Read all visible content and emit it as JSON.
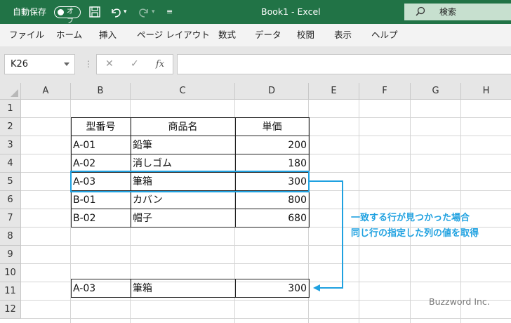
{
  "titlebar": {
    "autosave_label": "自動保存",
    "autosave_state": "オフ",
    "title": "Book1  -  Excel",
    "search_label": "検索",
    "bg_color": "#217346"
  },
  "menu": [
    "ファイル",
    "ホーム",
    "挿入",
    "ページ レイアウト",
    "数式",
    "データ",
    "校閲",
    "表示",
    "ヘルプ"
  ],
  "formula_bar": {
    "name_box": "K26",
    "cancel_icon": "✕",
    "enter_icon": "✓",
    "fx_label": "fx",
    "formula": ""
  },
  "columns": [
    "A",
    "B",
    "C",
    "D",
    "E",
    "F",
    "G",
    "H"
  ],
  "rows": [
    "1",
    "2",
    "3",
    "4",
    "5",
    "6",
    "7",
    "8",
    "9",
    "10",
    "11",
    "12"
  ],
  "table": {
    "headers": [
      "型番号",
      "商品名",
      "単価"
    ],
    "rows": [
      [
        "A-01",
        "鉛筆",
        "200"
      ],
      [
        "A-02",
        "消しゴム",
        "180"
      ],
      [
        "A-03",
        "筆箱",
        "300"
      ],
      [
        "B-01",
        "カバン",
        "800"
      ],
      [
        "B-02",
        "帽子",
        "680"
      ]
    ]
  },
  "result_row": [
    "A-03",
    "筆箱",
    "300"
  ],
  "annotation": {
    "line1": "一致する行が見つかった場合",
    "line2": "同じ行の指定した列の値を取得",
    "color": "#1fa1e0"
  },
  "watermark": "Buzzword Inc."
}
